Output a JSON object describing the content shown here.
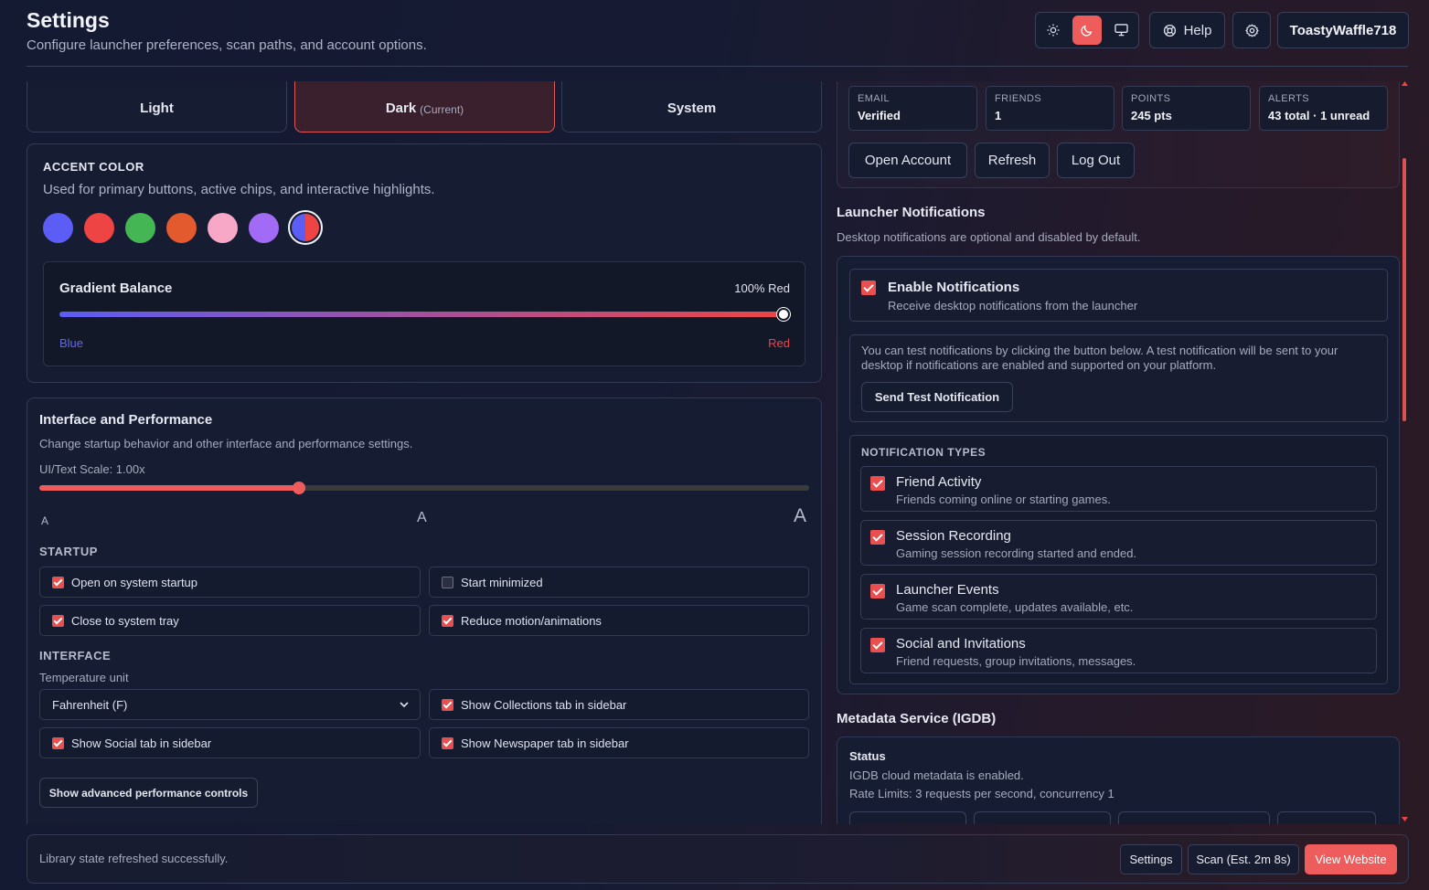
{
  "header": {
    "title": "Settings",
    "subtitle": "Configure launcher preferences, scan paths, and account options.",
    "help_label": "Help",
    "username": "ToastyWaffle718"
  },
  "theme": {
    "light": "Light",
    "dark": "Dark",
    "current": "(Current)",
    "system": "System"
  },
  "accent": {
    "heading": "ACCENT COLOR",
    "description": "Used for primary buttons, active chips, and interactive highlights.",
    "swatches": [
      "#5b5df5",
      "#ef4444",
      "#45b654",
      "#e35a2e",
      "#f7a8c6",
      "#a26bf5",
      "split-blue-red"
    ],
    "gradient": {
      "label": "Gradient Balance",
      "value_text": "100% Red",
      "value": 1.0,
      "left_label": "Blue",
      "right_label": "Red"
    }
  },
  "interface": {
    "title": "Interface and Performance",
    "description": "Change startup behavior and other interface and performance settings.",
    "scale_label": "UI/Text Scale: 1.00x",
    "scale_fraction": 0.337,
    "scale_glyph": "A",
    "startup_heading": "STARTUP",
    "open_startup": "Open on system startup",
    "start_minimized": "Start minimized",
    "close_tray": "Close to system tray",
    "reduce_motion": "Reduce motion/animations",
    "interface_heading": "INTERFACE",
    "temp_label": "Temperature unit",
    "temp_value": "Fahrenheit (F)",
    "show_collections": "Show Collections tab in sidebar",
    "show_social": "Show Social tab in sidebar",
    "show_newspaper": "Show Newspaper tab in sidebar",
    "advanced_btn": "Show advanced performance controls"
  },
  "account": {
    "stats": [
      {
        "key": "EMAIL",
        "value": "Verified"
      },
      {
        "key": "FRIENDS",
        "value": "1"
      },
      {
        "key": "POINTS",
        "value": "245 pts"
      },
      {
        "key": "ALERTS",
        "value": "43 total · 1 unread"
      }
    ],
    "open_account": "Open Account",
    "refresh": "Refresh",
    "log_out": "Log Out"
  },
  "notifications": {
    "title": "Launcher Notifications",
    "description": "Desktop notifications are optional and disabled by default.",
    "enable_title": "Enable Notifications",
    "enable_desc": "Receive desktop notifications from the launcher",
    "test_text": "You can test notifications by clicking the button below. A test notification will be sent to your desktop if notifications are enabled and supported on your platform.",
    "test_btn": "Send Test Notification",
    "types_heading": "NOTIFICATION TYPES",
    "types": [
      {
        "title": "Friend Activity",
        "desc": "Friends coming online or starting games."
      },
      {
        "title": "Session Recording",
        "desc": "Gaming session recording started and ended."
      },
      {
        "title": "Launcher Events",
        "desc": "Game scan complete, updates available, etc."
      },
      {
        "title": "Social and Invitations",
        "desc": "Friend requests, group invitations, messages."
      }
    ]
  },
  "metadata": {
    "title": "Metadata Service (IGDB)",
    "status_label": "Status",
    "status_text": "IGDB cloud metadata is enabled.",
    "rate_text": "Rate Limits: 3 requests per second, concurrency 1"
  },
  "footer": {
    "status": "Library state refreshed successfully.",
    "settings": "Settings",
    "scan": "Scan (Est. 2m 8s)",
    "website": "View Website"
  },
  "colors": {
    "accent": "#ef5c5c",
    "blue": "#5b5df5"
  }
}
